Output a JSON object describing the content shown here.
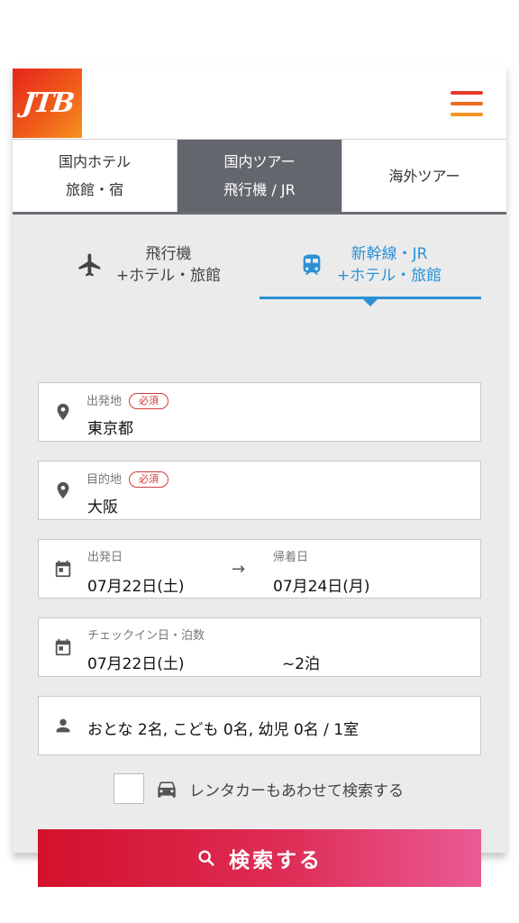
{
  "brand": {
    "logo_text": "JTB"
  },
  "colors": {
    "logo": "#ee4a1e",
    "tab_active_bg": "#63666c",
    "accent_blue": "#2a91d5",
    "required": "#d23a3a",
    "search_start": "#d3112b",
    "search_end": "#ea5b94"
  },
  "tabs": [
    {
      "line1": "国内ホテル",
      "line2": "旅館・宿",
      "active": false
    },
    {
      "line1": "国内ツアー",
      "line2": "飛行機 / JR",
      "active": true
    },
    {
      "line1": "海外ツアー",
      "line2": "",
      "active": false
    }
  ],
  "subtabs": [
    {
      "icon": "airplane-icon",
      "line1": "飛行機",
      "line2": "+ホテル・旅館",
      "active": false
    },
    {
      "icon": "train-icon",
      "line1": "新幹線・JR",
      "line2": "+ホテル・旅館",
      "active": true
    }
  ],
  "origin": {
    "label": "出発地",
    "required": "必須",
    "value": "東京都",
    "icon": "location-pin-icon"
  },
  "destination": {
    "label": "目的地",
    "required": "必須",
    "value": "大阪",
    "icon": "location-pin-icon"
  },
  "dates": {
    "depart_label": "出発日",
    "depart_value": "07月22日(土)",
    "arrow": "→",
    "return_label": "帰着日",
    "return_value": "07月24日(月)",
    "icon": "calendar-icon"
  },
  "checkin": {
    "label": "チェックイン日・泊数",
    "date_value": "07月22日(土)",
    "nights_value": "~2泊",
    "icon": "calendar-icon"
  },
  "guests": {
    "value": "おとな 2名, こども 0名, 幼児 0名 / 1室",
    "icon": "person-icon"
  },
  "rental_car": {
    "label": "レンタカーもあわせて検索する",
    "checked": false,
    "icon": "car-icon"
  },
  "search": {
    "label": "検索する",
    "icon": "search-icon"
  }
}
